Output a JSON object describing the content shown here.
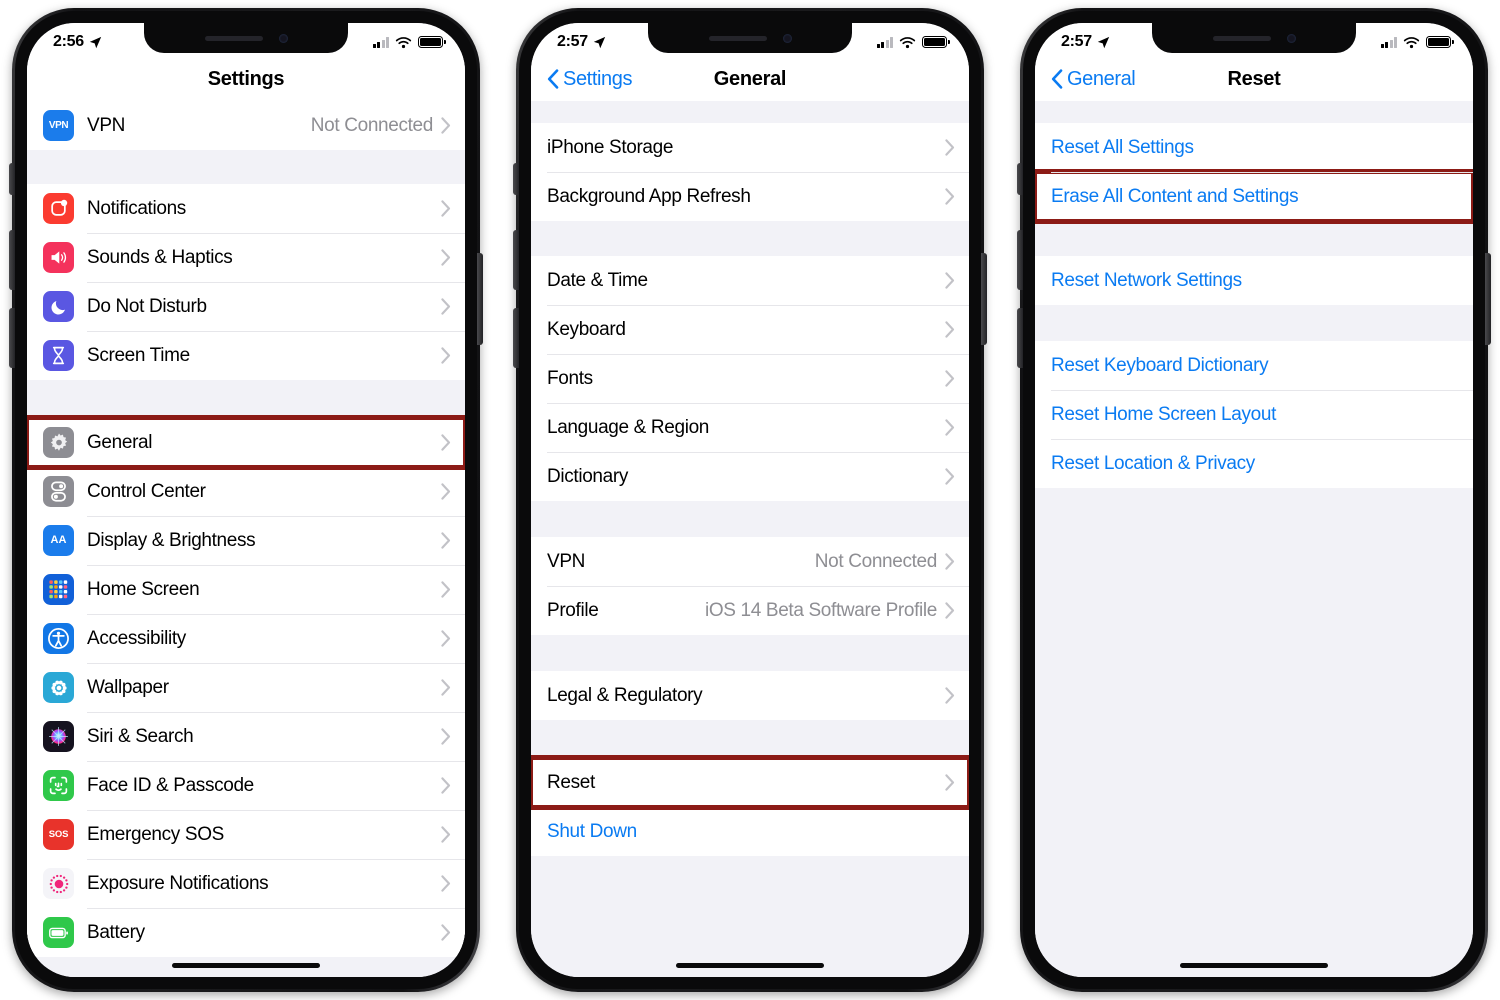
{
  "phones": [
    {
      "id": "phone-settings",
      "status": {
        "time": "2:56",
        "location_icon": "location-arrow-icon",
        "signal": "cellular-signal-icon",
        "wifi": "wifi-icon",
        "battery": "battery-icon"
      },
      "nav": {
        "back_label": "",
        "title": "Settings",
        "has_back": false
      },
      "sections": [
        {
          "gap_before": 0,
          "rows": [
            {
              "name": "vpn",
              "icon": "vpn-icon",
              "icon_class": "icn-vpn",
              "icon_text": "VPN",
              "label": "VPN",
              "value": "Not Connected",
              "chevron": true,
              "highlight": false,
              "indent": true
            }
          ]
        },
        {
          "gap_before": 34,
          "rows": [
            {
              "name": "notifications",
              "icon": "notifications-icon",
              "icon_class": "icn-notif",
              "label": "Notifications",
              "value": "",
              "chevron": true,
              "highlight": false,
              "indent": true
            },
            {
              "name": "sounds-haptics",
              "icon": "sounds-icon",
              "icon_class": "icn-sound",
              "label": "Sounds & Haptics",
              "value": "",
              "chevron": true,
              "highlight": false,
              "indent": true
            },
            {
              "name": "do-not-disturb",
              "icon": "moon-icon",
              "icon_class": "icn-dnd",
              "label": "Do Not Disturb",
              "value": "",
              "chevron": true,
              "highlight": false,
              "indent": true
            },
            {
              "name": "screen-time",
              "icon": "hourglass-icon",
              "icon_class": "icn-screen",
              "label": "Screen Time",
              "value": "",
              "chevron": true,
              "highlight": false,
              "indent": true
            }
          ]
        },
        {
          "gap_before": 38,
          "rows": [
            {
              "name": "general",
              "icon": "gear-icon",
              "icon_class": "icn-gen",
              "label": "General",
              "value": "",
              "chevron": true,
              "highlight": true,
              "indent": true
            },
            {
              "name": "control-center",
              "icon": "control-center-icon",
              "icon_class": "icn-cc",
              "label": "Control Center",
              "value": "",
              "chevron": true,
              "highlight": false,
              "indent": true
            },
            {
              "name": "display-brightness",
              "icon": "display-icon",
              "icon_class": "icn-disp",
              "icon_text": "AA",
              "label": "Display & Brightness",
              "value": "",
              "chevron": true,
              "highlight": false,
              "indent": true
            },
            {
              "name": "home-screen",
              "icon": "home-screen-icon",
              "icon_class": "icn-home",
              "label": "Home Screen",
              "value": "",
              "chevron": true,
              "highlight": false,
              "indent": true
            },
            {
              "name": "accessibility",
              "icon": "accessibility-icon",
              "icon_class": "icn-acc",
              "label": "Accessibility",
              "value": "",
              "chevron": true,
              "highlight": false,
              "indent": true
            },
            {
              "name": "wallpaper",
              "icon": "wallpaper-icon",
              "icon_class": "icn-wall",
              "label": "Wallpaper",
              "value": "",
              "chevron": true,
              "highlight": false,
              "indent": true
            },
            {
              "name": "siri-search",
              "icon": "siri-icon",
              "icon_class": "icn-siri",
              "label": "Siri & Search",
              "value": "",
              "chevron": true,
              "highlight": false,
              "indent": true
            },
            {
              "name": "face-id-passcode",
              "icon": "face-id-icon",
              "icon_class": "icn-face",
              "label": "Face ID & Passcode",
              "value": "",
              "chevron": true,
              "highlight": false,
              "indent": true
            },
            {
              "name": "emergency-sos",
              "icon": "sos-icon",
              "icon_class": "icn-sos",
              "icon_text": "SOS",
              "label": "Emergency SOS",
              "value": "",
              "chevron": true,
              "highlight": false,
              "indent": true
            },
            {
              "name": "exposure-notifications",
              "icon": "exposure-icon",
              "icon_class": "icn-exp",
              "label": "Exposure Notifications",
              "value": "",
              "chevron": true,
              "highlight": false,
              "indent": true
            },
            {
              "name": "battery",
              "icon": "battery-app-icon",
              "icon_class": "icn-batt",
              "label": "Battery",
              "value": "",
              "chevron": true,
              "highlight": false,
              "indent": true
            }
          ]
        }
      ]
    },
    {
      "id": "phone-general",
      "status": {
        "time": "2:57",
        "location_icon": "location-arrow-icon",
        "signal": "cellular-signal-icon",
        "wifi": "wifi-icon",
        "battery": "battery-icon"
      },
      "nav": {
        "back_label": "Settings",
        "title": "General",
        "has_back": true
      },
      "sections": [
        {
          "gap_before": 22,
          "rows": [
            {
              "name": "iphone-storage",
              "icon": "",
              "label": "iPhone Storage",
              "value": "",
              "chevron": true,
              "highlight": false,
              "indent": false
            },
            {
              "name": "background-app-refresh",
              "icon": "",
              "label": "Background App Refresh",
              "value": "",
              "chevron": true,
              "highlight": false,
              "indent": false
            }
          ]
        },
        {
          "gap_before": 35,
          "rows": [
            {
              "name": "date-time",
              "icon": "",
              "label": "Date & Time",
              "value": "",
              "chevron": true,
              "highlight": false,
              "indent": false
            },
            {
              "name": "keyboard",
              "icon": "",
              "label": "Keyboard",
              "value": "",
              "chevron": true,
              "highlight": false,
              "indent": false
            },
            {
              "name": "fonts",
              "icon": "",
              "label": "Fonts",
              "value": "",
              "chevron": true,
              "highlight": false,
              "indent": false
            },
            {
              "name": "language-region",
              "icon": "",
              "label": "Language & Region",
              "value": "",
              "chevron": true,
              "highlight": false,
              "indent": false
            },
            {
              "name": "dictionary",
              "icon": "",
              "label": "Dictionary",
              "value": "",
              "chevron": true,
              "highlight": false,
              "indent": false
            }
          ]
        },
        {
          "gap_before": 36,
          "rows": [
            {
              "name": "vpn",
              "icon": "",
              "label": "VPN",
              "value": "Not Connected",
              "chevron": true,
              "highlight": false,
              "indent": false
            },
            {
              "name": "profile",
              "icon": "",
              "label": "Profile",
              "value": "iOS 14 Beta Software Profile",
              "chevron": true,
              "highlight": false,
              "indent": false
            }
          ]
        },
        {
          "gap_before": 36,
          "rows": [
            {
              "name": "legal-regulatory",
              "icon": "",
              "label": "Legal & Regulatory",
              "value": "",
              "chevron": true,
              "highlight": false,
              "indent": false
            }
          ]
        },
        {
          "gap_before": 38,
          "rows": [
            {
              "name": "reset",
              "icon": "",
              "label": "Reset",
              "value": "",
              "chevron": true,
              "highlight": true,
              "indent": false
            },
            {
              "name": "shut-down",
              "icon": "",
              "label": "Shut Down",
              "value": "",
              "chevron": false,
              "highlight": false,
              "indent": false,
              "blue": true
            }
          ]
        }
      ]
    },
    {
      "id": "phone-reset",
      "status": {
        "time": "2:57",
        "location_icon": "location-arrow-icon",
        "signal": "cellular-signal-icon",
        "wifi": "wifi-icon",
        "battery": "battery-icon"
      },
      "nav": {
        "back_label": "General",
        "title": "Reset",
        "has_back": true
      },
      "sections": [
        {
          "gap_before": 22,
          "rows": [
            {
              "name": "reset-all-settings",
              "icon": "",
              "label": "Reset All Settings",
              "value": "",
              "chevron": false,
              "highlight": false,
              "indent": false,
              "blue": true
            },
            {
              "name": "erase-all-content-and-settings",
              "icon": "",
              "label": "Erase All Content and Settings",
              "value": "",
              "chevron": false,
              "highlight": true,
              "indent": false,
              "blue": true
            }
          ]
        },
        {
          "gap_before": 35,
          "rows": [
            {
              "name": "reset-network-settings",
              "icon": "",
              "label": "Reset Network Settings",
              "value": "",
              "chevron": false,
              "highlight": false,
              "indent": false,
              "blue": true
            }
          ]
        },
        {
          "gap_before": 36,
          "rows": [
            {
              "name": "reset-keyboard-dictionary",
              "icon": "",
              "label": "Reset Keyboard Dictionary",
              "value": "",
              "chevron": false,
              "highlight": false,
              "indent": false,
              "blue": true
            },
            {
              "name": "reset-home-screen-layout",
              "icon": "",
              "label": "Reset Home Screen Layout",
              "value": "",
              "chevron": false,
              "highlight": false,
              "indent": false,
              "blue": true
            },
            {
              "name": "reset-location-privacy",
              "icon": "",
              "label": "Reset Location & Privacy",
              "value": "",
              "chevron": false,
              "highlight": false,
              "indent": false,
              "blue": true
            }
          ]
        }
      ]
    }
  ],
  "colors": {
    "accent_blue": "#0a7bf2",
    "highlight_red": "#8c1b16",
    "list_bg": "#f2f2f7",
    "row_bg": "#ffffff",
    "secondary_text": "#8e8e93"
  }
}
